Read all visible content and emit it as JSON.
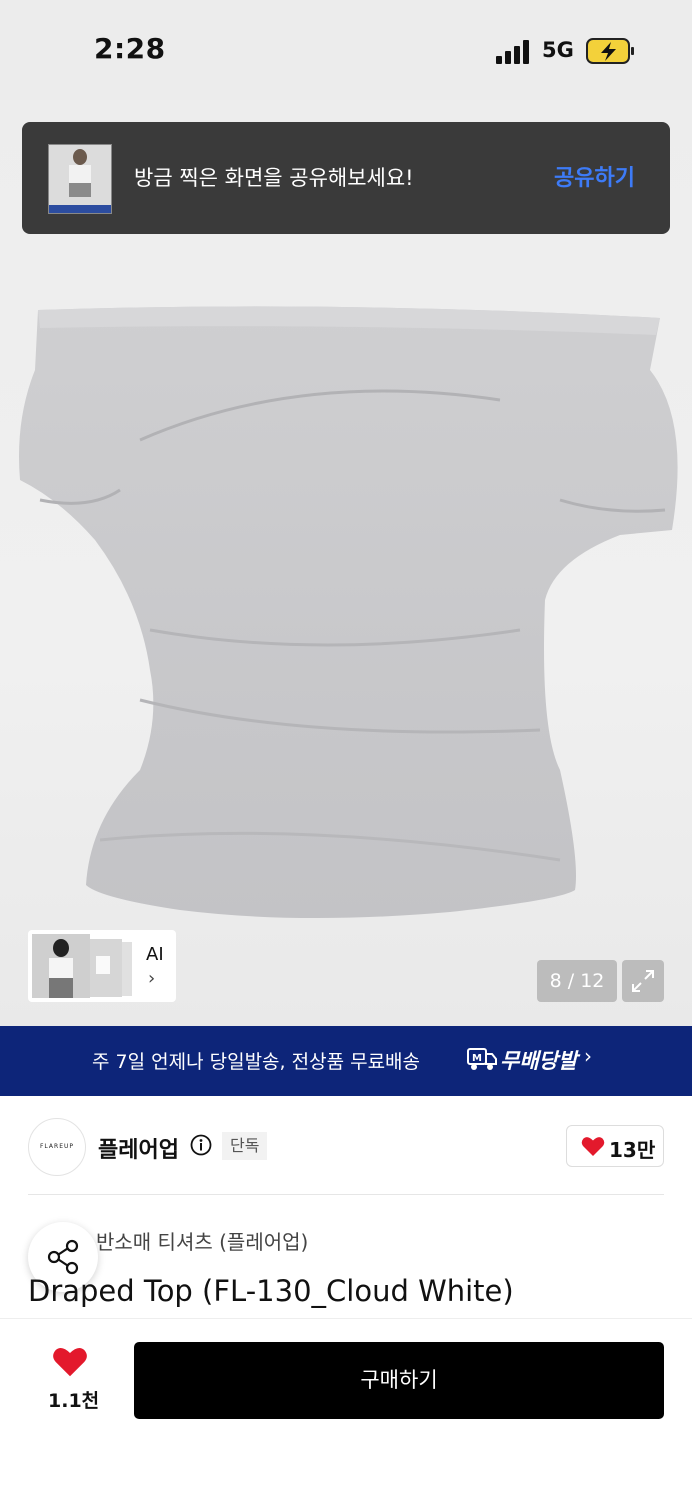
{
  "status_bar": {
    "time": "2:28",
    "network": "5G"
  },
  "toast": {
    "message": "방금 찍은 화면을 공유해보세요!",
    "action": "공유하기"
  },
  "gallery": {
    "ai_label": "AI",
    "ai_chevron": "›",
    "counter": "8 / 12"
  },
  "banner": {
    "text": "주 7일 언제나 당일발송, 전상품 무료배송",
    "brand": "무배당발",
    "chevron": "›"
  },
  "brand": {
    "logo_text": "FLAREUP",
    "name": "플레어업",
    "badge": "단독",
    "likes": "13만"
  },
  "product": {
    "category": "반소매 티셔츠 (플레어업)",
    "title": "Draped Top (FL-130_Cloud White)"
  },
  "bottom": {
    "wish_count": "1.1천",
    "buy_label": "구매하기"
  },
  "icons": {
    "signal": "signal-icon",
    "battery": "battery-charging-icon",
    "info": "info-icon",
    "heart": "heart-icon",
    "share": "share-icon",
    "expand": "expand-icon",
    "truck": "truck-icon"
  },
  "colors": {
    "accent_blue": "#3d7bf7",
    "banner_navy": "#0d2579",
    "heart_red": "#e3192c",
    "battery_yellow": "#f3d13a"
  }
}
